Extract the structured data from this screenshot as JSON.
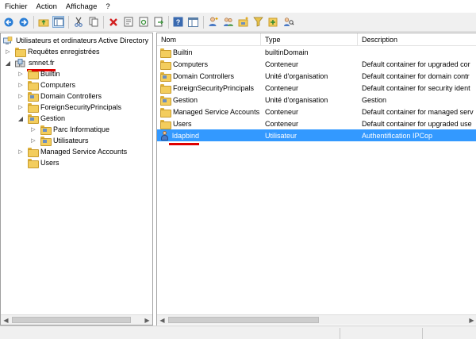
{
  "menu": [
    "Fichier",
    "Action",
    "Affichage",
    "?"
  ],
  "toolbar": {
    "icons": [
      "back-icon",
      "forward-icon",
      "up-folder-icon",
      "show-tree-icon",
      "cut-icon",
      "copy-icon",
      "delete-icon",
      "properties-icon",
      "refresh-icon",
      "export-icon",
      "help-icon",
      "console-icon",
      "new-user-icon",
      "new-group-icon",
      "new-ou-icon",
      "filter-icon",
      "add-to-group-icon",
      "find-icon"
    ]
  },
  "tree": {
    "root": "Utilisateurs et ordinateurs Active Directory",
    "saved_queries": "Requêtes enregistrées",
    "domain": "smnet.fr",
    "items": {
      "builtin": "Builtin",
      "computers": "Computers",
      "domain_controllers": "Domain Controllers",
      "foreign": "ForeignSecurityPrincipals",
      "gestion": "Gestion",
      "parc": "Parc Informatique",
      "utilisateurs": "Utilisateurs",
      "msa": "Managed Service Accounts",
      "users": "Users"
    }
  },
  "list": {
    "headers": {
      "name": "Nom",
      "type": "Type",
      "description": "Description"
    },
    "rows": [
      {
        "name": "Builtin",
        "type": "builtinDomain",
        "description": "",
        "icon": "folder-icon"
      },
      {
        "name": "Computers",
        "type": "Conteneur",
        "description": "Default container for upgraded cor",
        "icon": "folder-icon"
      },
      {
        "name": "Domain Controllers",
        "type": "Unité d'organisation",
        "description": "Default container for domain contr",
        "icon": "ou-icon"
      },
      {
        "name": "ForeignSecurityPrincipals",
        "type": "Conteneur",
        "description": "Default container for security ident",
        "icon": "folder-icon"
      },
      {
        "name": "Gestion",
        "type": "Unité d'organisation",
        "description": "Gestion",
        "icon": "ou-icon"
      },
      {
        "name": "Managed Service Accounts",
        "type": "Conteneur",
        "description": "Default container for managed serv",
        "icon": "folder-icon"
      },
      {
        "name": "Users",
        "type": "Conteneur",
        "description": "Default container for upgraded use",
        "icon": "folder-icon"
      },
      {
        "name": "ldapbind",
        "type": "Utilisateur",
        "description": "Authentification IPCop",
        "icon": "user-icon"
      }
    ],
    "selected_index": 7
  },
  "colors": {
    "selection": "#3399ff",
    "annotation_underline": "#e00000"
  }
}
